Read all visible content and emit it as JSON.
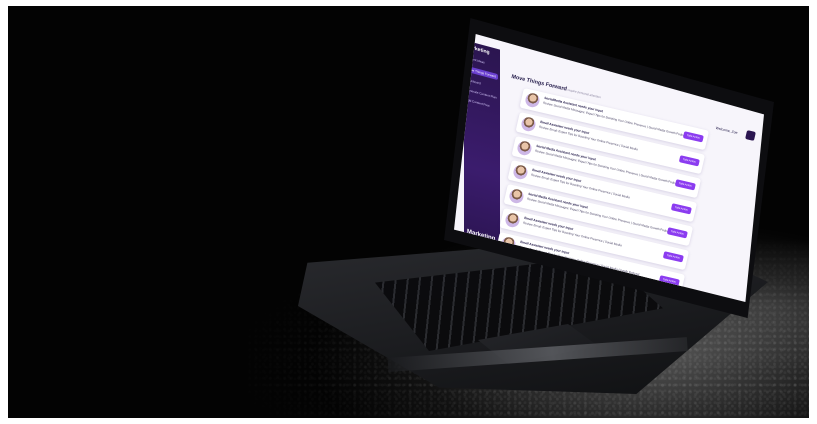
{
  "scene": {
    "description_label": "Laptop showing marketing dashboard",
    "colors": {
      "background": "#030303",
      "sidebar": "#2b1550",
      "accent": "#8b3cf0"
    }
  },
  "app": {
    "logo": "Marketing",
    "sidebar_items": [
      "Content Ideas",
      "Move Things Forward",
      "Dashboard",
      "Generate Content Plan",
      "Add Content Post"
    ],
    "brand": "Marketing",
    "page_title": "Move Things Forward",
    "page_subtitle": "Actions that require personal attention",
    "topbar_right": "Welcome, Zoe",
    "cards": [
      {
        "title": "SocialMedia Assistant needs your input",
        "text": "Review Social Media Messages: Expert Tips for Boosting Your Online Presence | Social Media Growth Podcast",
        "button": "Take Action"
      },
      {
        "title": "Email Assistant needs your input",
        "text": "Review Email: Expert Tips for Boosting Your Online Presence | Social Media",
        "button": "Take Action"
      },
      {
        "title": "Social Media Assistant needs your input",
        "text": "Review Social Media Messages: Expert Tips for Boosting Your Online Presence | Social Media Growth Podcast",
        "button": "Take Action"
      },
      {
        "title": "Email Assistant needs your input",
        "text": "Review Email: Expert Tips for Boosting Your Online Presence | Social Media",
        "button": "Take Action"
      },
      {
        "title": "Social Media Assistant needs your input",
        "text": "Review Social Media Messages: Expert Tips for Boosting Your Online Presence | Social Media Growth Podcast",
        "button": "Take Action"
      },
      {
        "title": "Email Assistant needs your input",
        "text": "Review Email: Expert Tips for Boosting Your Online Presence | Social Media",
        "button": "Take Action"
      },
      {
        "title": "Email Assistant needs your input",
        "text": "Review Email: Expert Tips for Boosting Your Online Presence | Social Media Growth Podcast",
        "button": "Take Action"
      }
    ]
  }
}
